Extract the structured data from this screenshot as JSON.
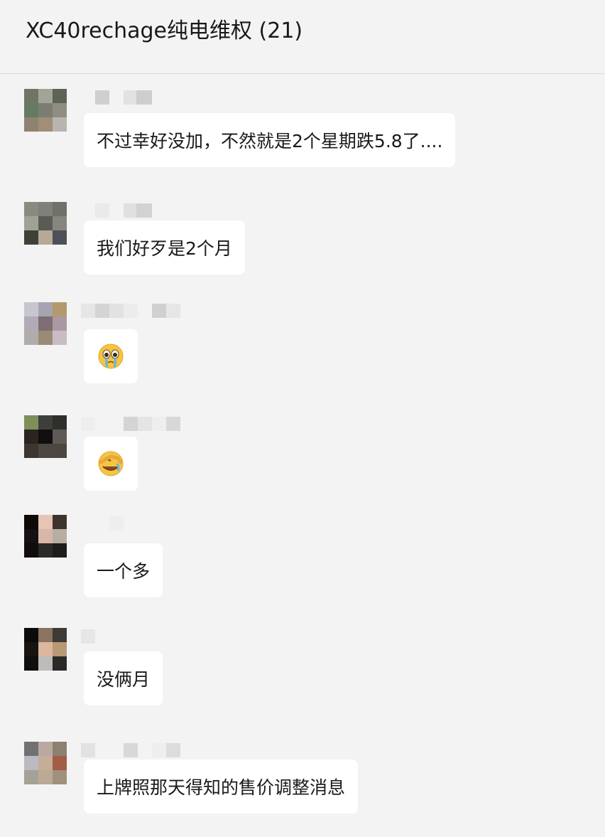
{
  "chat": {
    "title": "XC40rechage纯电维权 (21)"
  },
  "messages": [
    {
      "type": "text",
      "text": "不过幸好没加，不然就是2个星期跌5.8了....",
      "avatar_colors": [
        "#6f7565",
        "#a2a596",
        "#5d6356",
        "#667a62",
        "#7c7d72",
        "#8f8d82",
        "#8e8370",
        "#a08e77",
        "#b7b5ae"
      ]
    },
    {
      "type": "text",
      "text": "我们好歹是2个月",
      "avatar_colors": [
        "#898a80",
        "#807f78",
        "#6e7268",
        "#9ea495",
        "#5a5b54",
        "#85877e",
        "#3f4037",
        "#b6aa96",
        "#4f5057"
      ]
    },
    {
      "type": "emoji",
      "emoji": "crying-face",
      "avatar_colors": [
        "#c7c6cf",
        "#a6a4b0",
        "#b39a6c",
        "#b3a9b8",
        "#7e6e73",
        "#ab98a2",
        "#b0acab",
        "#9b8b76",
        "#c9bcc5"
      ]
    },
    {
      "type": "emoji",
      "emoji": "facepalm-crying",
      "avatar_colors": [
        "#7f8f5a",
        "#3d3f3b",
        "#2f2f2b",
        "#2b2421",
        "#100e0f",
        "#5f5a55",
        "#3c3530",
        "#4d4741",
        "#4c463e"
      ]
    },
    {
      "type": "text",
      "text": "一个多",
      "avatar_colors": [
        "#0d0a08",
        "#e7c4b4",
        "#3d342c",
        "#141110",
        "#d9b7a8",
        "#b7aea2",
        "#0f0c0b",
        "#2d2a28",
        "#201c19"
      ]
    },
    {
      "type": "text",
      "text": "没俩月",
      "avatar_colors": [
        "#0c0b0a",
        "#8b7261",
        "#3e3a34",
        "#171412",
        "#dcb69d",
        "#b99876",
        "#100e0d",
        "#bdbcb9",
        "#2b2a28"
      ]
    },
    {
      "type": "text",
      "text": "上牌照那天得知的售价调整消息",
      "avatar_colors": [
        "#727171",
        "#b9a9a0",
        "#8e8071",
        "#bcb9c3",
        "#c6ad98",
        "#a15d45",
        "#a6a196",
        "#bba996",
        "#a1907c"
      ]
    }
  ],
  "colors": {
    "background": "#f3f3f3",
    "bubble": "#ffffff",
    "text": "#191919"
  }
}
